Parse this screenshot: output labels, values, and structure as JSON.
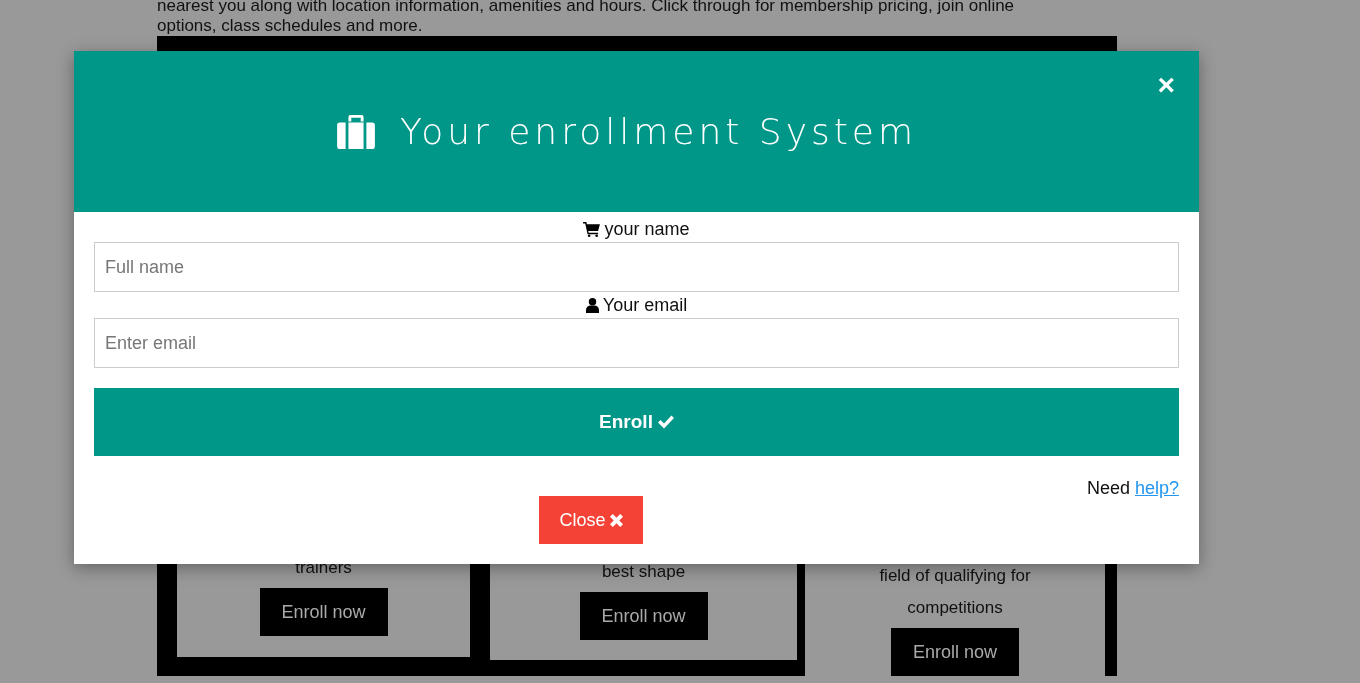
{
  "background": {
    "intro_lines": [
      "nearest you along with location information, amenities and hours. Click through for membership pricing, join online",
      "options, class schedules and more."
    ],
    "cards": [
      {
        "lines": [
          "trainers"
        ],
        "button": "Enroll now"
      },
      {
        "lines": [
          "best shape"
        ],
        "button": "Enroll now"
      },
      {
        "lines": [
          "field of qualifying for",
          "competitions"
        ],
        "button": "Enroll now"
      }
    ]
  },
  "modal": {
    "title": "Your enrollment System",
    "close_symbol": "×",
    "fields": [
      {
        "label": "your name",
        "kind": "name",
        "placeholder": "Full name"
      },
      {
        "label": "Your email",
        "kind": "email",
        "placeholder": "Enter email"
      }
    ],
    "enroll_button": "Enroll",
    "help_text": "Need",
    "help_link": "help?",
    "close_button": "Close"
  }
}
